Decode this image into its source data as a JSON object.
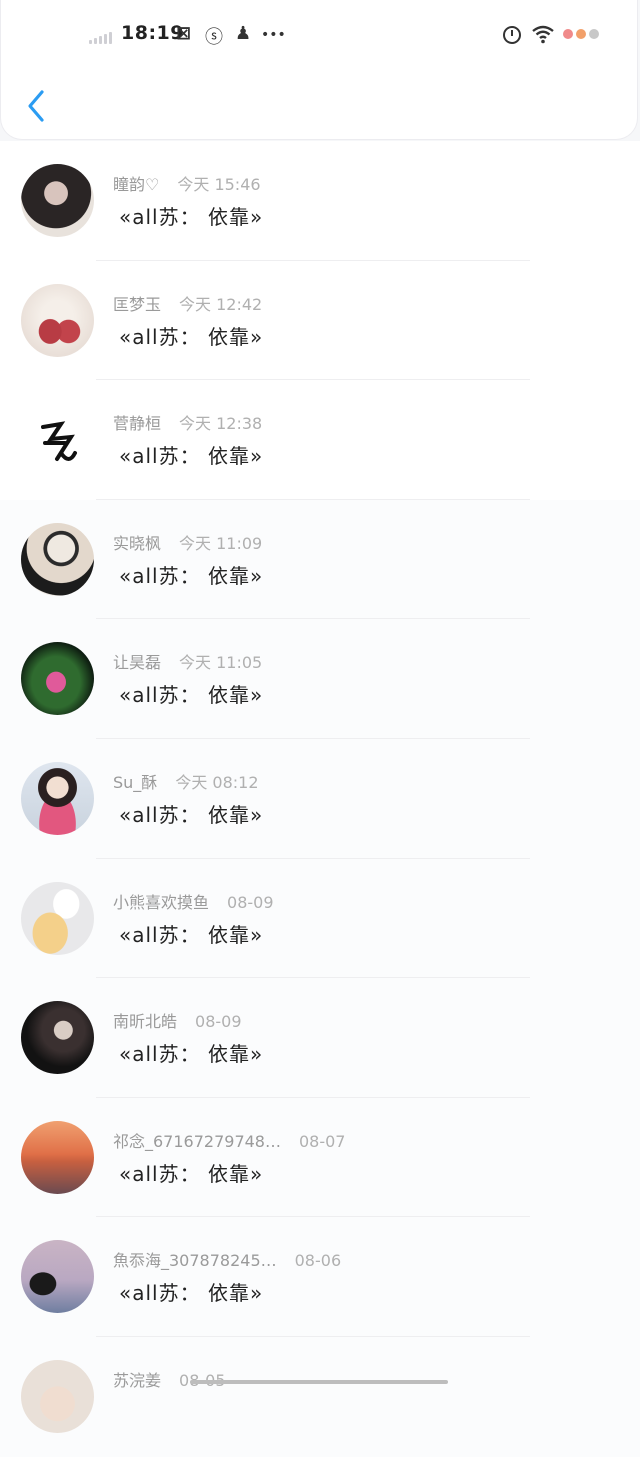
{
  "status_bar": {
    "time": "18:19",
    "icons": [
      "signal-icon",
      "sim-icon",
      "weibo-icon",
      "qq-icon",
      "more-icon",
      "alarm-icon",
      "wifi-icon",
      "battery-icon"
    ],
    "more_text": "•••"
  },
  "header": {
    "back_icon": "chevron-left-icon",
    "accent": "#2b9cf2"
  },
  "items": [
    {
      "name": "瞳韵♡",
      "date": "今天 15:46",
      "title": "«all苏： 依靠»"
    },
    {
      "name": "匡梦玉",
      "date": "今天 12:42",
      "title": "«all苏： 依靠»"
    },
    {
      "name": "菅静桓",
      "date": "今天 12:38",
      "title": "«all苏： 依靠»"
    },
    {
      "name": "实晓枫",
      "date": "今天 11:09",
      "title": "«all苏： 依靠»"
    },
    {
      "name": "让昊磊",
      "date": "今天 11:05",
      "title": "«all苏： 依靠»"
    },
    {
      "name": "Su_酥",
      "date": "今天 08:12",
      "title": "«all苏： 依靠»"
    },
    {
      "name": "小熊喜欢摸鱼",
      "date": "08-09",
      "title": "«all苏： 依靠»"
    },
    {
      "name": "南昕北皓",
      "date": "08-09",
      "title": "«all苏： 依靠»"
    },
    {
      "name": "祁念_67167279748…",
      "date": "08-07",
      "title": "«all苏： 依靠»"
    },
    {
      "name": "魚忝海_307878245…",
      "date": "08-06",
      "title": "«all苏： 依靠»"
    },
    {
      "name": "苏浣姜",
      "date": "08-05",
      "title": ""
    }
  ]
}
